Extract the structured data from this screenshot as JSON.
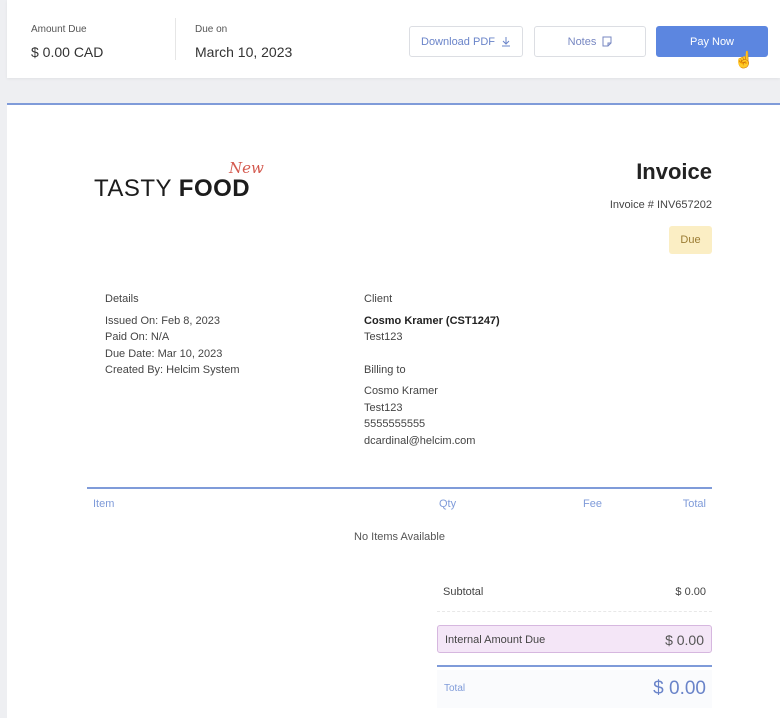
{
  "topbar": {
    "amount_due_label": "Amount Due",
    "amount_due_value": "$ 0.00 CAD",
    "due_on_label": "Due on",
    "due_on_value": "March 10, 2023",
    "download_pdf_label": "Download PDF",
    "notes_label": "Notes",
    "pay_now_label": "Pay Now"
  },
  "logo": {
    "word1": "TASTY ",
    "word2": "FOOD",
    "new": "New"
  },
  "invoice": {
    "title": "Invoice",
    "number": "Invoice # INV657202",
    "status": "Due"
  },
  "details": {
    "header": "Details",
    "issued_on": "Issued On:  Feb 8, 2023",
    "paid_on": "Paid On:  N/A",
    "due_date": "Due Date:  Mar 10, 2023",
    "created_by": "Created By:  Helcim System"
  },
  "client": {
    "header": "Client",
    "name": "Cosmo Kramer (CST1247)",
    "company": "Test123",
    "billing_header": "Billing to",
    "billing_name": "Cosmo Kramer",
    "billing_company": "Test123",
    "billing_phone": "5555555555",
    "billing_email": "dcardinal@helcim.com"
  },
  "table": {
    "col_item": "Item",
    "col_qty": "Qty",
    "col_fee": "Fee",
    "col_total": "Total",
    "empty_text": "No Items Available"
  },
  "summary": {
    "subtotal_label": "Subtotal",
    "subtotal_value": "$ 0.00",
    "internal_label": "Internal Amount Due",
    "internal_value": "$ 0.00",
    "total_label": "Total",
    "total_value": "$ 0.00"
  },
  "colors": {
    "accent": "#5c86e0",
    "rule": "#7f9bd9",
    "due_badge": "#fbeec4",
    "internal_bg": "#f4e6f7"
  }
}
